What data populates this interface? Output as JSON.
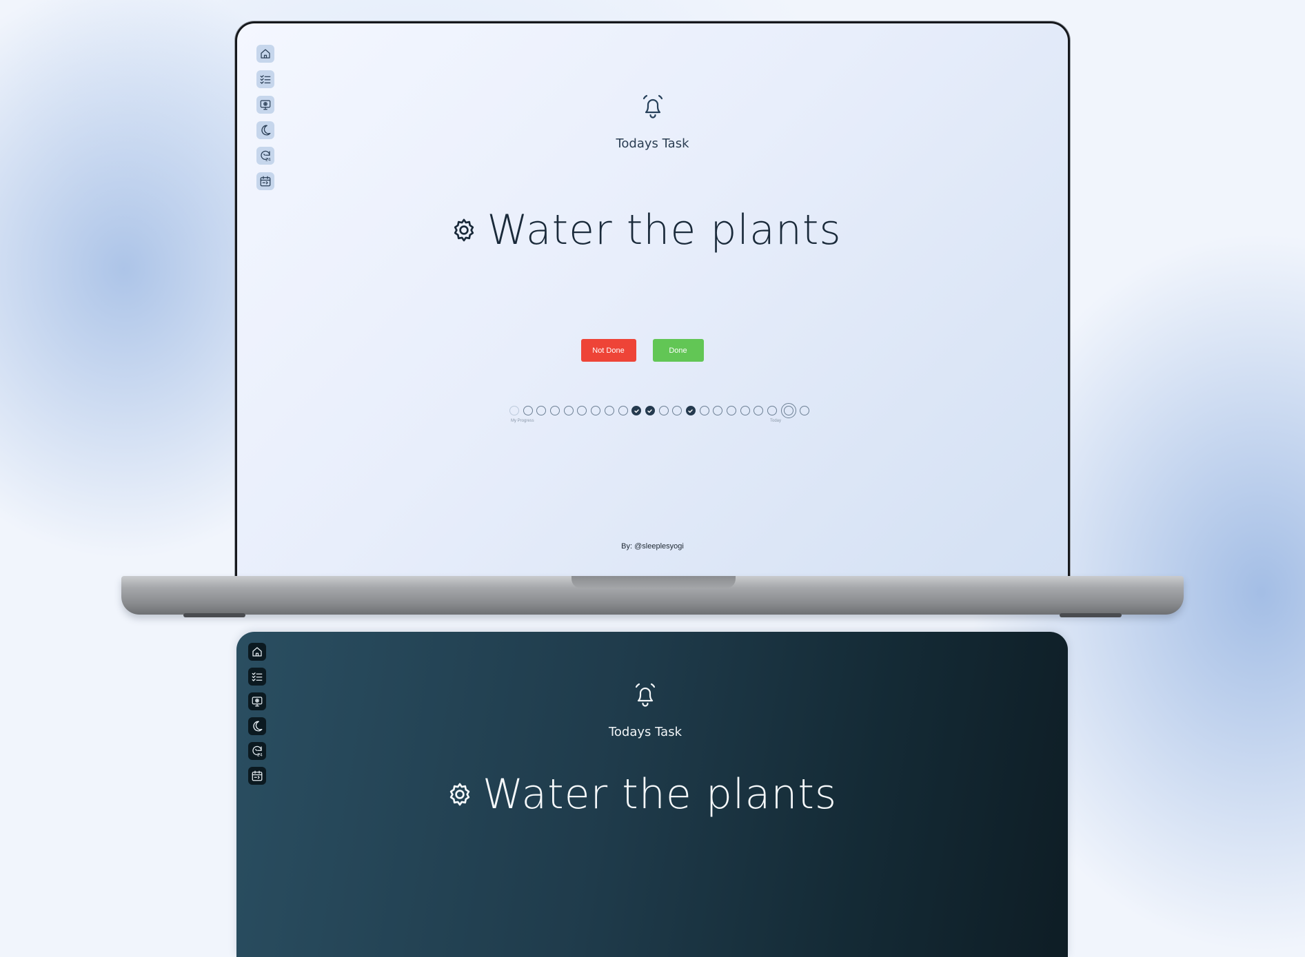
{
  "colors": {
    "light_bg_start": "#f4f7ff",
    "light_bg_end": "#d3e0f3",
    "dark_bg_start": "#2a4e61",
    "dark_bg_end": "#0e1d25",
    "not_done_button": "#ee4437",
    "done_button": "#62c655",
    "completed_dot": "#253a4f"
  },
  "sidebar": {
    "items": [
      {
        "icon": "home-icon"
      },
      {
        "icon": "checklist-icon"
      },
      {
        "icon": "monitor-icon"
      },
      {
        "icon": "moon-icon"
      },
      {
        "icon": "24hr-refresh-icon"
      },
      {
        "icon": "calendar-icon"
      }
    ]
  },
  "header": {
    "title": "Todays Task",
    "icon": "bell-icon"
  },
  "task": {
    "icon": "gear-icon",
    "title": "Water the plants"
  },
  "actions": {
    "not_done_label": "Not Done",
    "done_label": "Done"
  },
  "progress": {
    "start_label": "My Progress",
    "today_label": "Today",
    "days": [
      "faint",
      "empty",
      "empty",
      "empty",
      "empty",
      "empty",
      "empty",
      "empty",
      "empty",
      "done",
      "done",
      "empty",
      "empty",
      "done",
      "empty",
      "empty",
      "empty",
      "empty",
      "empty",
      "empty",
      "today",
      "empty"
    ]
  },
  "footer": {
    "credit": "By: @sleeplesyogi"
  }
}
